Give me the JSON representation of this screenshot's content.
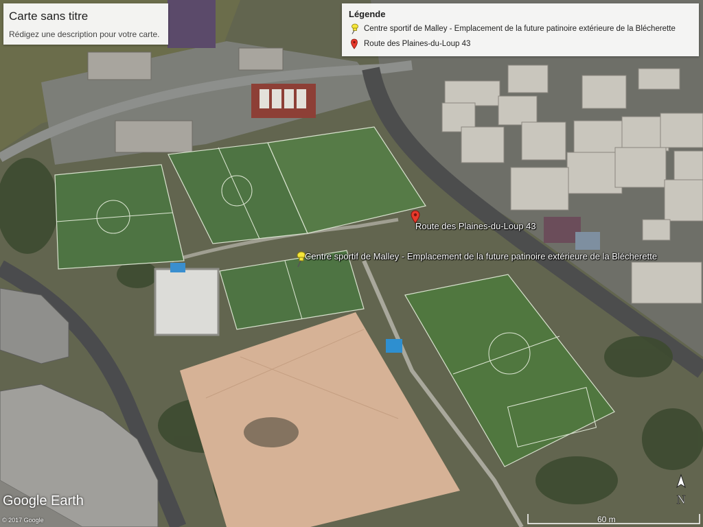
{
  "map": {
    "title": "Carte sans titre",
    "description": "Rédigez une description pour votre carte."
  },
  "legend": {
    "heading": "Légende",
    "items": [
      {
        "icon": "yellow-pushpin-icon",
        "label": "Centre sportif de Malley - Emplacement de la future patinoire extérieure de la Blécherette"
      },
      {
        "icon": "red-pin-icon",
        "label": "Route des Plaines-du-Loup 43"
      }
    ]
  },
  "placemarks": {
    "sports_center": {
      "label": "Centre sportif de Malley - Emplacement de la future patinoire extérieure  de la Blécherette",
      "icon": "yellow-pushpin-icon"
    },
    "address": {
      "label": "Route des Plaines-du-Loup 43",
      "icon": "red-pin-icon"
    }
  },
  "branding": {
    "logo": "Google Earth",
    "copyright": "© 2017 Google"
  },
  "scale": {
    "label": "60 m"
  },
  "compass": {
    "label": "N"
  },
  "colors": {
    "pin_yellow": "#f5e63a",
    "pin_red": "#e8392b",
    "grass": "#4d7040",
    "sand": "#d7b396"
  }
}
